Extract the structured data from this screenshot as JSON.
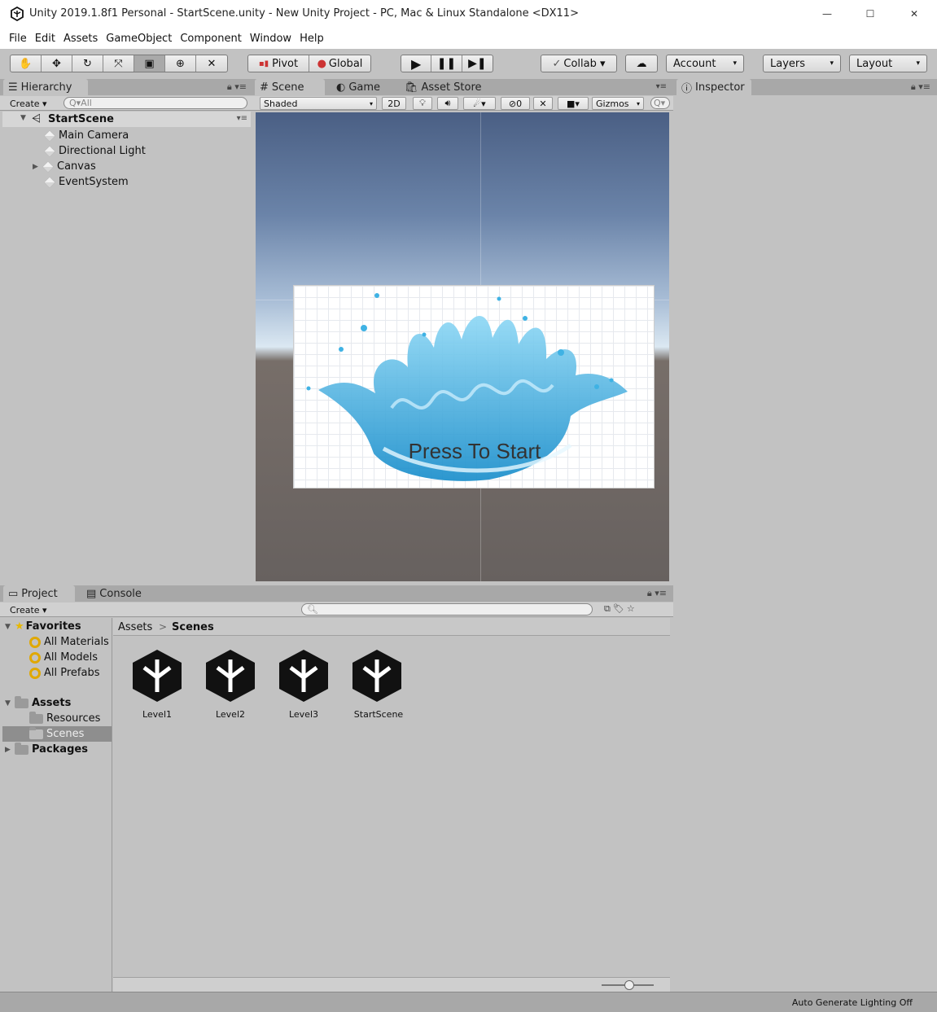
{
  "window": {
    "title": "Unity 2019.1.8f1 Personal - StartScene.unity - New Unity Project - PC, Mac & Linux Standalone <DX11>",
    "min_symbol": "—",
    "max_symbol": "☐",
    "close_symbol": "✕"
  },
  "menu": [
    "File",
    "Edit",
    "Assets",
    "GameObject",
    "Component",
    "Window",
    "Help"
  ],
  "toolbar": {
    "pivot": "Pivot",
    "global": "Global",
    "collab": "Collab ▾",
    "account": "Account",
    "layers": "Layers",
    "layout": "Layout",
    "dropdown_arrow": "▾"
  },
  "hierarchy": {
    "tab": "Hierarchy",
    "create": "Create ▾",
    "search_placeholder": "Q▾All",
    "scene": "StartScene",
    "items": [
      "Main Camera",
      "Directional Light",
      "Canvas",
      "EventSystem"
    ]
  },
  "scene_view": {
    "tabs": [
      "Scene",
      "Game",
      "Asset Store"
    ],
    "shading": "Shaded",
    "mode_2d": "2D",
    "hidden_count": "0",
    "gizmos": "Gizmos",
    "canvas_text": "Press To Start"
  },
  "inspector": {
    "tab": "Inspector"
  },
  "project": {
    "tabs": [
      "Project",
      "Console"
    ],
    "create": "Create ▾",
    "favorites_label": "Favorites",
    "favorites": [
      "All Materials",
      "All Models",
      "All Prefabs"
    ],
    "assets_label": "Assets",
    "asset_folders": [
      "Resources",
      "Scenes"
    ],
    "packages_label": "Packages",
    "breadcrumb_root": "Assets",
    "breadcrumb_sep": ">",
    "breadcrumb_current": "Scenes",
    "scenes": [
      "Level1",
      "Level2",
      "Level3",
      "StartScene"
    ]
  },
  "status_bar": {
    "text": "Auto Generate Lighting Off"
  },
  "colors": {
    "panel": "#c2c2c2",
    "tabbar": "#a8a8a8",
    "selection": "#8e8e8e",
    "water": "#3fb2e4"
  }
}
